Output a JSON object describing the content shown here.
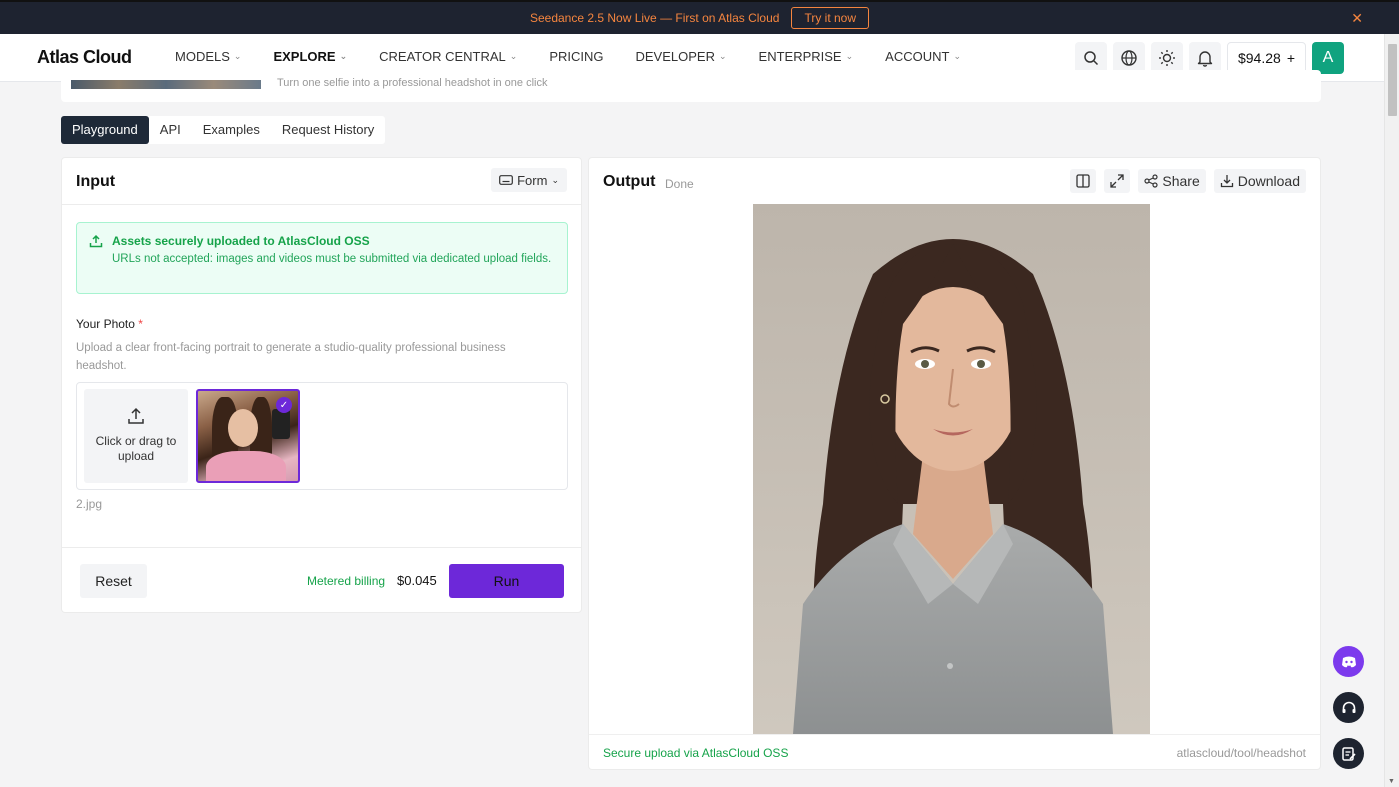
{
  "banner": {
    "text": "Seedance 2.5 Now Live — First on Atlas Cloud",
    "cta": "Try it now",
    "close": "✕"
  },
  "nav": {
    "logo": "Atlas Cloud",
    "items": [
      {
        "label": "MODELS",
        "has_menu": true
      },
      {
        "label": "EXPLORE",
        "has_menu": true,
        "active": true
      },
      {
        "label": "CREATOR CENTRAL",
        "has_menu": true
      },
      {
        "label": "PRICING",
        "has_menu": false
      },
      {
        "label": "DEVELOPER",
        "has_menu": true
      },
      {
        "label": "ENTERPRISE",
        "has_menu": true
      },
      {
        "label": "ACCOUNT",
        "has_menu": true
      }
    ],
    "balance": "$94.28",
    "balance_add": "+",
    "avatar_letter": "A"
  },
  "tool": {
    "description": "Turn one selfie into a professional headshot in one click"
  },
  "tabs": [
    "Playground",
    "API",
    "Examples",
    "Request History"
  ],
  "input": {
    "title": "Input",
    "mode": "Form",
    "notice_title": "Assets securely uploaded to AtlasCloud OSS",
    "notice_body": "URLs not accepted: images and videos must be submitted via dedicated upload fields.",
    "field_label": "Your Photo",
    "required_mark": "*",
    "field_desc": "Upload a clear front-facing portrait to generate a studio-quality professional business headshot.",
    "upload_text": "Click or drag to upload",
    "filename": "2.jpg",
    "reset": "Reset",
    "billing_label": "Metered billing",
    "price": "$0.045",
    "run": "Run"
  },
  "output": {
    "title": "Output",
    "status": "Done",
    "share": "Share",
    "download": "Download",
    "secure_note": "Secure upload via AtlasCloud OSS",
    "path": "atlascloud/tool/headshot"
  },
  "colors": {
    "accent": "#6d28d9",
    "success": "#16a34a",
    "banner_bg": "#1e2330",
    "banner_text": "#f5853f"
  }
}
